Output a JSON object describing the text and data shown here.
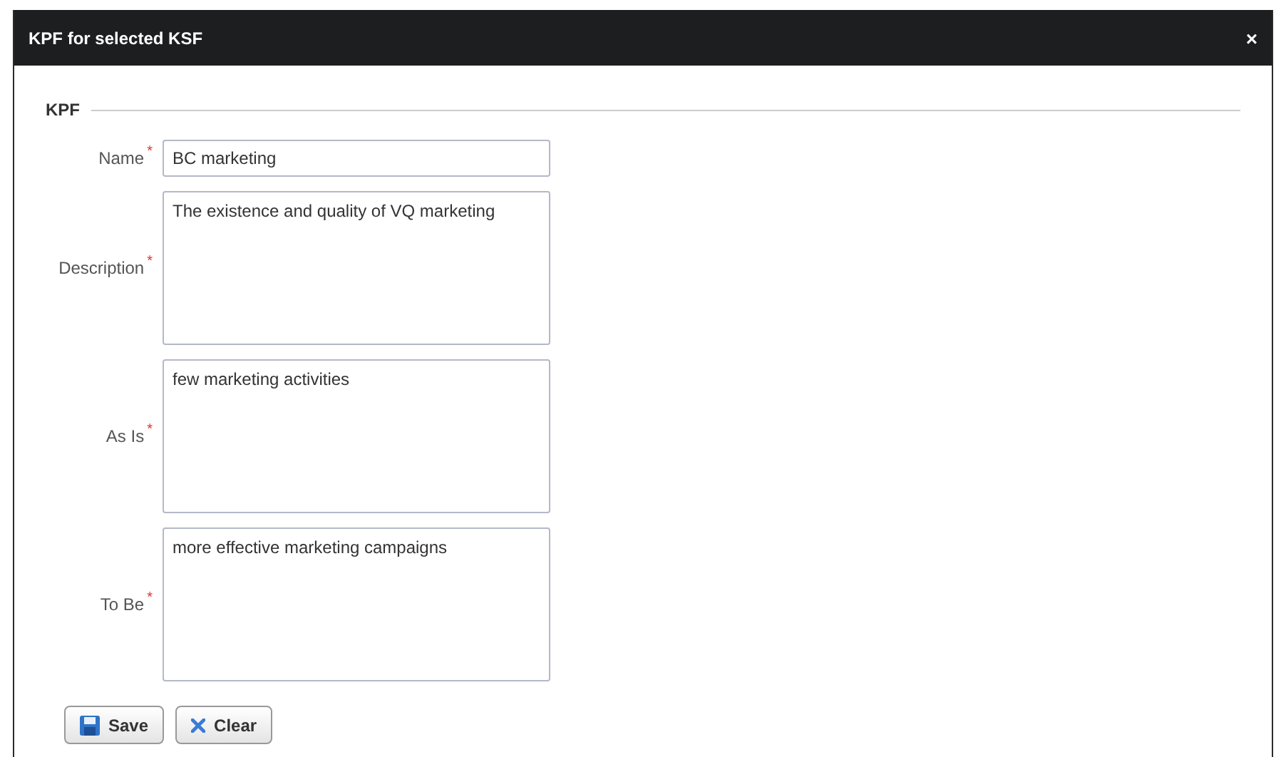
{
  "window": {
    "title": "KPF for selected KSF",
    "close": "×"
  },
  "fieldset": {
    "legend": "KPF"
  },
  "fields": [
    {
      "kind": "input",
      "label": "Name",
      "required_mark": "*",
      "value": "BC marketing"
    },
    {
      "kind": "textarea",
      "label": "Description",
      "required_mark": "*",
      "value": "The existence and quality of VQ marketing"
    },
    {
      "kind": "textarea",
      "label": "As Is",
      "required_mark": "*",
      "value": "few marketing activities"
    },
    {
      "kind": "textarea",
      "label": "To Be",
      "required_mark": "*",
      "value": "more effective marketing campaigns"
    }
  ],
  "buttons": [
    {
      "kind": "save",
      "label": "Save"
    },
    {
      "kind": "clear",
      "label": "Clear"
    }
  ]
}
